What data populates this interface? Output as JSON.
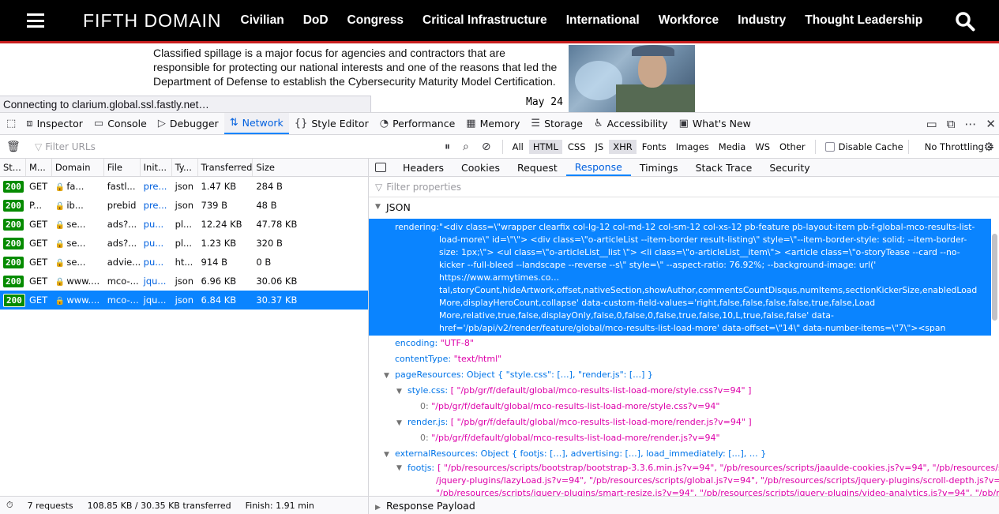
{
  "site": {
    "logo": "FIFTH DOMAIN",
    "nav": [
      "Civilian",
      "DoD",
      "Congress",
      "Critical Infrastructure",
      "International",
      "Workforce",
      "Industry",
      "Thought Leadership"
    ],
    "article_lines": [
      "Classified spillage is a major focus for agencies and contractors that are",
      "responsible for protecting our national interests and one of the reasons that led the",
      "Department of Defense to establish the Cybersecurity Maturity Model Certification."
    ],
    "date": "May 24",
    "status": "Connecting to clarium.global.ssl.fastly.net…"
  },
  "devtools": {
    "tools": [
      "Inspector",
      "Console",
      "Debugger",
      "Network",
      "Style Editor",
      "Performance",
      "Memory",
      "Storage",
      "Accessibility",
      "What's New"
    ],
    "selected_tool": "Network",
    "filter_placeholder": "Filter URLs",
    "filter_types": [
      "All",
      "HTML",
      "CSS",
      "JS",
      "XHR",
      "Fonts",
      "Images",
      "Media",
      "WS",
      "Other"
    ],
    "active_types": [
      "HTML",
      "XHR"
    ],
    "disable_cache": "Disable Cache",
    "throttling": "No Throttling ÷",
    "columns": [
      "St...",
      "M...",
      "Domain",
      "File",
      "Init...",
      "Ty...",
      "Transferred",
      "Size"
    ],
    "requests": [
      {
        "status": "200",
        "method": "GET",
        "domain": "fa...",
        "file": "fastl...",
        "init": "pre...",
        "type": "json",
        "transferred": "1.47 KB",
        "size": "284 B"
      },
      {
        "status": "200",
        "method": "P...",
        "domain": "ib...",
        "file": "prebid",
        "init": "pre...",
        "type": "json",
        "transferred": "739 B",
        "size": "48 B"
      },
      {
        "status": "200",
        "method": "GET",
        "domain": "se...",
        "file": "ads?...",
        "init": "pu...",
        "type": "pl...",
        "transferred": "12.24 KB",
        "size": "47.78 KB"
      },
      {
        "status": "200",
        "method": "GET",
        "domain": "se...",
        "file": "ads?...",
        "init": "pu...",
        "type": "pl...",
        "transferred": "1.23 KB",
        "size": "320 B"
      },
      {
        "status": "200",
        "method": "GET",
        "domain": "se...",
        "file": "advie...",
        "init": "pu...",
        "type": "ht...",
        "transferred": "914 B",
        "size": "0 B"
      },
      {
        "status": "200",
        "method": "GET",
        "domain": "www....",
        "file": "mco-...",
        "init": "jqu...",
        "type": "json",
        "transferred": "6.96 KB",
        "size": "30.06 KB"
      },
      {
        "status": "200",
        "method": "GET",
        "domain": "www....",
        "file": "mco-...",
        "init": "jqu...",
        "type": "json",
        "transferred": "6.84 KB",
        "size": "30.37 KB"
      }
    ],
    "selected_request_index": 6,
    "detail_tabs": [
      "Headers",
      "Cookies",
      "Request",
      "Response",
      "Timings",
      "Stack Trace",
      "Security"
    ],
    "selected_detail_tab": "Response",
    "prop_filter_placeholder": "Filter properties",
    "json_label": "JSON",
    "rendering_key": "rendering:",
    "rendering_value": "\"<div class=\\\"wrapper clearfix col-lg-12 col-md-12 col-sm-12 col-xs-12 pb-feature pb-layout-item pb-f-global-mco-results-list-load-more\\\" id=\\\"\\\"> <div class=\\\"o-articleList --item-border result-listing\\\" style=\\\"--item-border-style: solid; --item-border-size: 1px;\\\"> <ul class=\\\"o-articleList__list \\\"> <li class=\\\"o-articleList__item\\\"> <article class=\\\"o-storyTease --card --no-kicker --full-bleed --landscape --reverse --s\\\" style=\\\" --aspect-ratio: 76.92%; --background-image: url(' https://www.armytimes.co… tal,storyCount,hideArtwork,offset,nativeSection,showAuthor,commentsCountDisqus,numItems,sectionKickerSize,enabledLoadMore,displayHeroCount,collapse' data-custom-field-values='right,false,false,false,false,true,false,Load More,relative,true,false,displayOnly,false,0,false,0,false,true,false,10,L,true,false,false' data-href='/pb/api/v2/render/feature/global/mco-results-list-load-more' data-offset=\\\"14\\\" data-number-items=\\\"7\\\"><span class=\\\"atype-button__label\\\">Load More</span> </button> </div> </div>\"",
    "encoding_key": "encoding:",
    "encoding_value": "\"UTF-8\"",
    "contentType_key": "contentType:",
    "contentType_value": "\"text/html\"",
    "pageResources_key": "pageResources:",
    "pageResources_value": "Object { \"style.css\": […], \"render.js\": […] }",
    "stylecss_key": "style.css:",
    "stylecss_value": "[ \"/pb/gr/f/default/global/mco-results-list-load-more/style.css?v=94\" ]",
    "stylecss_0_key": "0:",
    "stylecss_0_value": "\"/pb/gr/f/default/global/mco-results-list-load-more/style.css?v=94\"",
    "renderjs_key": "render.js:",
    "renderjs_value": "[ \"/pb/gr/f/default/global/mco-results-list-load-more/render.js?v=94\" ]",
    "renderjs_0_key": "0:",
    "renderjs_0_value": "\"/pb/gr/f/default/global/mco-results-list-load-more/render.js?v=94\"",
    "externalResources_key": "externalResources:",
    "externalResources_value": "Object { footjs: […], advertising: […], load_immediately: […], … }",
    "footjs_key": "footjs:",
    "footjs_line1": "[ \"/pb/resources/scripts/bootstrap/bootstrap-3.3.6.min.js?v=94\", \"/pb/resources/scripts/jaaulde-cookies.js?v=94\", \"/pb/resources/scripts",
    "footjs_line2": "/jquery-plugins/lazyLoad.js?v=94\", \"/pb/resources/scripts/global.js?v=94\", \"/pb/resources/scripts/jquery-plugins/scroll-depth.js?v=94\",",
    "footjs_line3": "\"/pb/resources/scripts/jquery-plugins/smart-resize.js?v=94\", \"/pb/resources/scripts/jquery-plugins/video-analytics.js?v=94\", \"/pb/resources",
    "summary": {
      "requests": "7 requests",
      "size": "108.85 KB / 30.35 KB transferred",
      "finish": "Finish: 1.91 min"
    },
    "response_payload": "Response Payload"
  }
}
